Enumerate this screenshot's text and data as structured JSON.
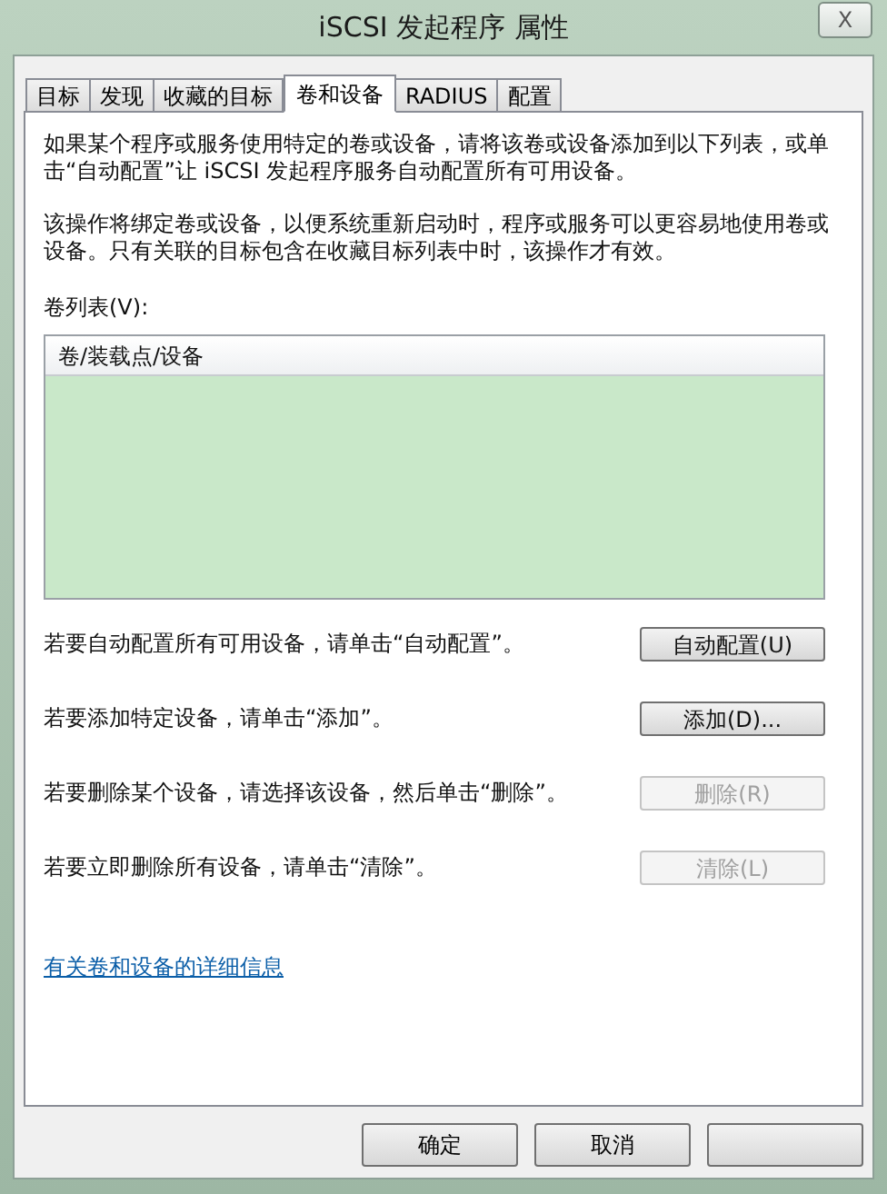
{
  "window": {
    "title": "iSCSI 发起程序 属性",
    "close": "X"
  },
  "tabs": [
    {
      "label": "目标",
      "selected": false
    },
    {
      "label": "发现",
      "selected": false
    },
    {
      "label": "收藏的目标",
      "selected": false
    },
    {
      "label": "卷和设备",
      "selected": true
    },
    {
      "label": "RADIUS",
      "selected": false
    },
    {
      "label": "配置",
      "selected": false
    }
  ],
  "intro": [
    "如果某个程序或服务使用特定的卷或设备，请将该卷或设备添加到以下列表，或单击“自动配置”让 iSCSI 发起程序服务自动配置所有可用设备。",
    "该操作将绑定卷或设备，以便系统重新启动时，程序或服务可以更容易地使用卷或设备。只有关联的目标包含在收藏目标列表中时，该操作才有效。"
  ],
  "volume_list": {
    "label": "卷列表(V):",
    "columns": [
      "卷/装载点/设备"
    ]
  },
  "actions": [
    {
      "text": "若要自动配置所有可用设备，请单击“自动配置”。",
      "button": {
        "label": "自动配置(U)",
        "disabled": false
      }
    },
    {
      "text": "若要添加特定设备，请单击“添加”。",
      "button": {
        "label": "添加(D)...",
        "disabled": false
      }
    },
    {
      "text": "若要删除某个设备，请选择该设备，然后单击“删除”。",
      "button": {
        "label": "删除(R)",
        "disabled": true
      }
    },
    {
      "text": "若要立即删除所有设备，请单击“清除”。",
      "button": {
        "label": "清除(L)",
        "disabled": true
      }
    }
  ],
  "link": "有关卷和设备的详细信息",
  "buttons": [
    {
      "kind": "labeled",
      "label": "确定"
    },
    {
      "kind": "labeled",
      "label": "取消"
    },
    {
      "kind": "blank"
    }
  ]
}
